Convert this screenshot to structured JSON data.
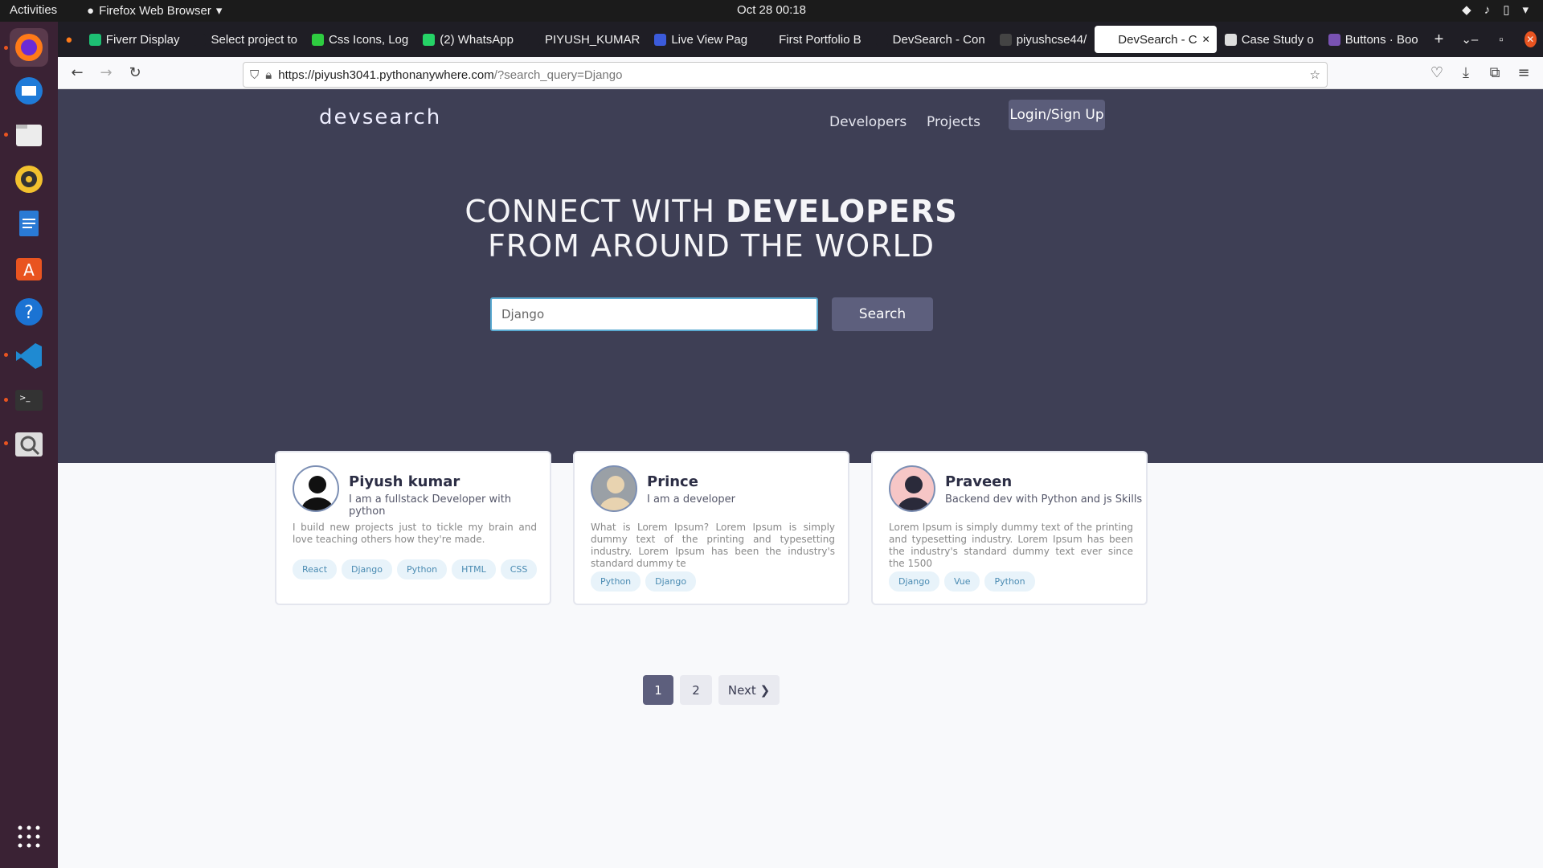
{
  "os": {
    "activities": "Activities",
    "app_name": "Firefox Web Browser",
    "clock": "Oct 28  00:18"
  },
  "dock": {
    "apps": [
      "firefox-icon",
      "thunderbird-icon",
      "files-icon",
      "rhythmbox-icon",
      "writer-icon",
      "software-center-icon",
      "help-icon",
      "vscode-icon",
      "terminal-icon",
      "magnifier-icon"
    ]
  },
  "browser": {
    "tabs": [
      {
        "label": "Fiverr Display",
        "color": "#1dbf73"
      },
      {
        "label": "Select project to",
        "color": "#1f1e25"
      },
      {
        "label": "Css Icons, Log",
        "color": "#2ecc40"
      },
      {
        "label": "(2) WhatsApp",
        "color": "#25d366"
      },
      {
        "label": "PIYUSH_KUMAR",
        "color": "#1f1e25"
      },
      {
        "label": "Live View Pag",
        "color": "#3b5bdb"
      },
      {
        "label": "First Portfolio B",
        "color": "#1f1e25"
      },
      {
        "label": "DevSearch - Con",
        "color": "#1f1e25"
      },
      {
        "label": "piyushcse44/",
        "color": "#444"
      },
      {
        "label": "DevSearch - C",
        "color": "#ffffff",
        "active": true
      },
      {
        "label": "Case Study o",
        "color": "#ddd"
      },
      {
        "label": "Buttons · Boo",
        "color": "#7952b3"
      }
    ],
    "url_domain": "https://piyush3041.pythonanywhere.com",
    "url_path": "/?search_query=Django"
  },
  "site": {
    "logo": "devsearch",
    "nav": {
      "developers": "Developers",
      "projects": "Projects",
      "login": "Login/Sign Up"
    },
    "headline_line1_light": "CONNECT WITH ",
    "headline_line1_bold": "DEVELOPERS",
    "headline_line2": "FROM AROUND THE WORLD",
    "search_value": "Django",
    "search_button": "Search"
  },
  "developers": [
    {
      "name": "Piyush kumar",
      "headline": "I am a fullstack Developer with python",
      "bio": "I build new projects just to tickle my brain and love teaching others how they're made.",
      "skills": [
        "React",
        "Django",
        "Python",
        "HTML",
        "CSS"
      ]
    },
    {
      "name": "Prince",
      "headline": "I am a developer",
      "bio": "What is Lorem Ipsum? Lorem Ipsum is simply dummy text of the printing and typesetting industry. Lorem Ipsum has been the industry's standard dummy te",
      "skills": [
        "Python",
        "Django"
      ]
    },
    {
      "name": "Praveen",
      "headline": "Backend dev with Python and js Skills",
      "bio": "Lorem Ipsum is simply dummy text of the printing and typesetting industry. Lorem Ipsum has been the industry's standard dummy text ever since the 1500",
      "skills": [
        "Django",
        "Vue",
        "Python"
      ]
    }
  ],
  "pagination": {
    "page1": "1",
    "page2": "2",
    "next": "Next ❯"
  }
}
